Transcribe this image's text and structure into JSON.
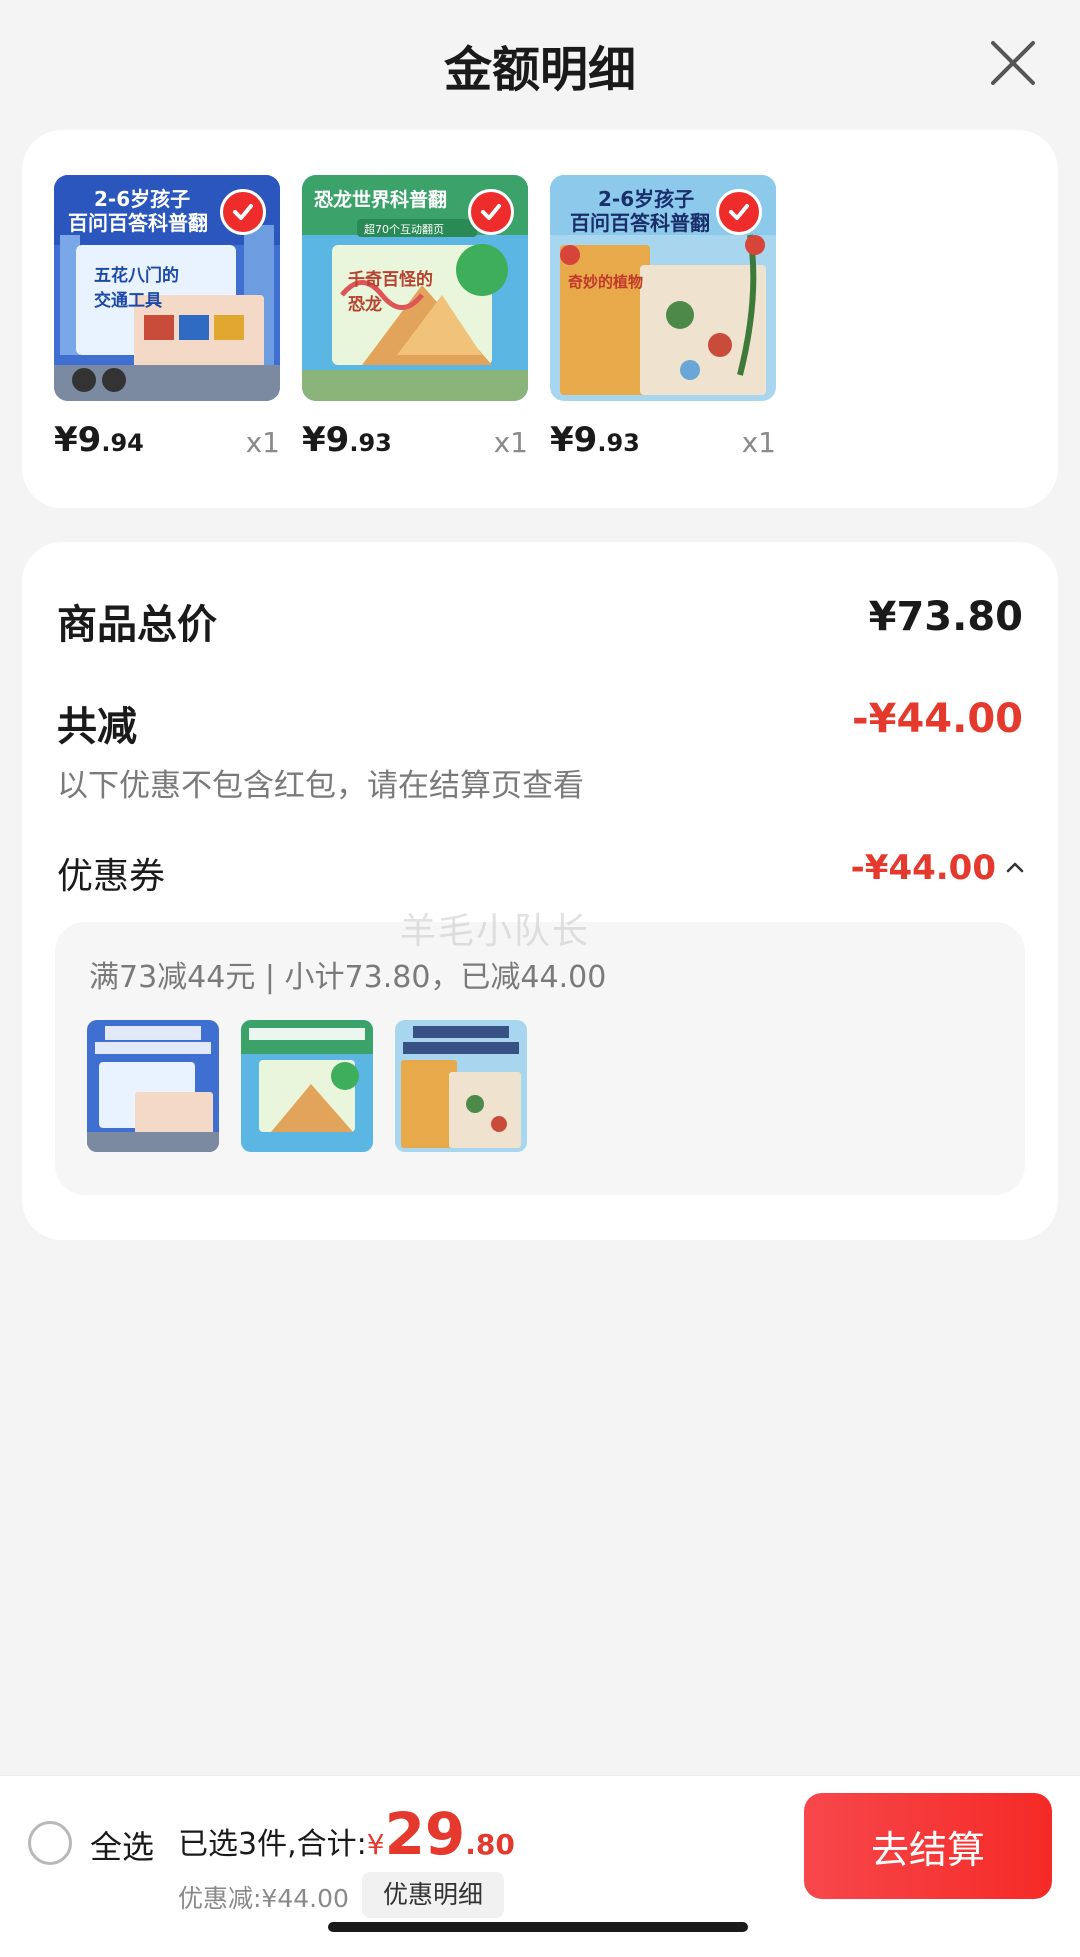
{
  "header": {
    "title": "金额明细"
  },
  "products": [
    {
      "price_int": "¥9",
      "price_dec": ".94",
      "qty": "x1",
      "cover_title": "2-6岁孩子",
      "cover_sub": "百问百答科普翻",
      "cover_book": "五花八门的交通工具",
      "theme": "transport"
    },
    {
      "price_int": "¥9",
      "price_dec": ".93",
      "qty": "x1",
      "cover_title": "恐龙世界科普翻",
      "cover_sub": "超70个互动翻页",
      "cover_book": "千奇百怪的恐龙",
      "theme": "dinosaur"
    },
    {
      "price_int": "¥9",
      "price_dec": ".93",
      "qty": "x1",
      "cover_title": "2-6岁孩子",
      "cover_sub": "百问百答科普翻",
      "cover_book": "奇妙的植物",
      "theme": "plants"
    }
  ],
  "summary": {
    "total_label": "商品总价",
    "total_value": "¥73.80",
    "reduce_label": "共减",
    "reduce_value": "-¥44.00",
    "note": "以下优惠不包含红包，请在结算页查看",
    "coupon_label": "优惠券",
    "coupon_value": "-¥44.00",
    "coupon_desc": "满73减44元 | 小计73.80，已减44.00",
    "watermark": "羊毛小队长"
  },
  "footer": {
    "select_all": "全选",
    "selected_text": "已选3件,合计:",
    "total_symbol": "¥",
    "total_int": "29",
    "total_dec": ".80",
    "discount": "优惠减:¥44.00",
    "detail_button": "优惠明细",
    "checkout_button": "去结算"
  },
  "colors": {
    "accent_red": "#e5392d",
    "check_red": "#ef2c2c",
    "card_bg": "#ffffff",
    "page_bg": "#f4f4f4"
  },
  "icons": {
    "close": "close-icon",
    "check": "check-icon",
    "chevron_up": "chevron-up-icon"
  }
}
